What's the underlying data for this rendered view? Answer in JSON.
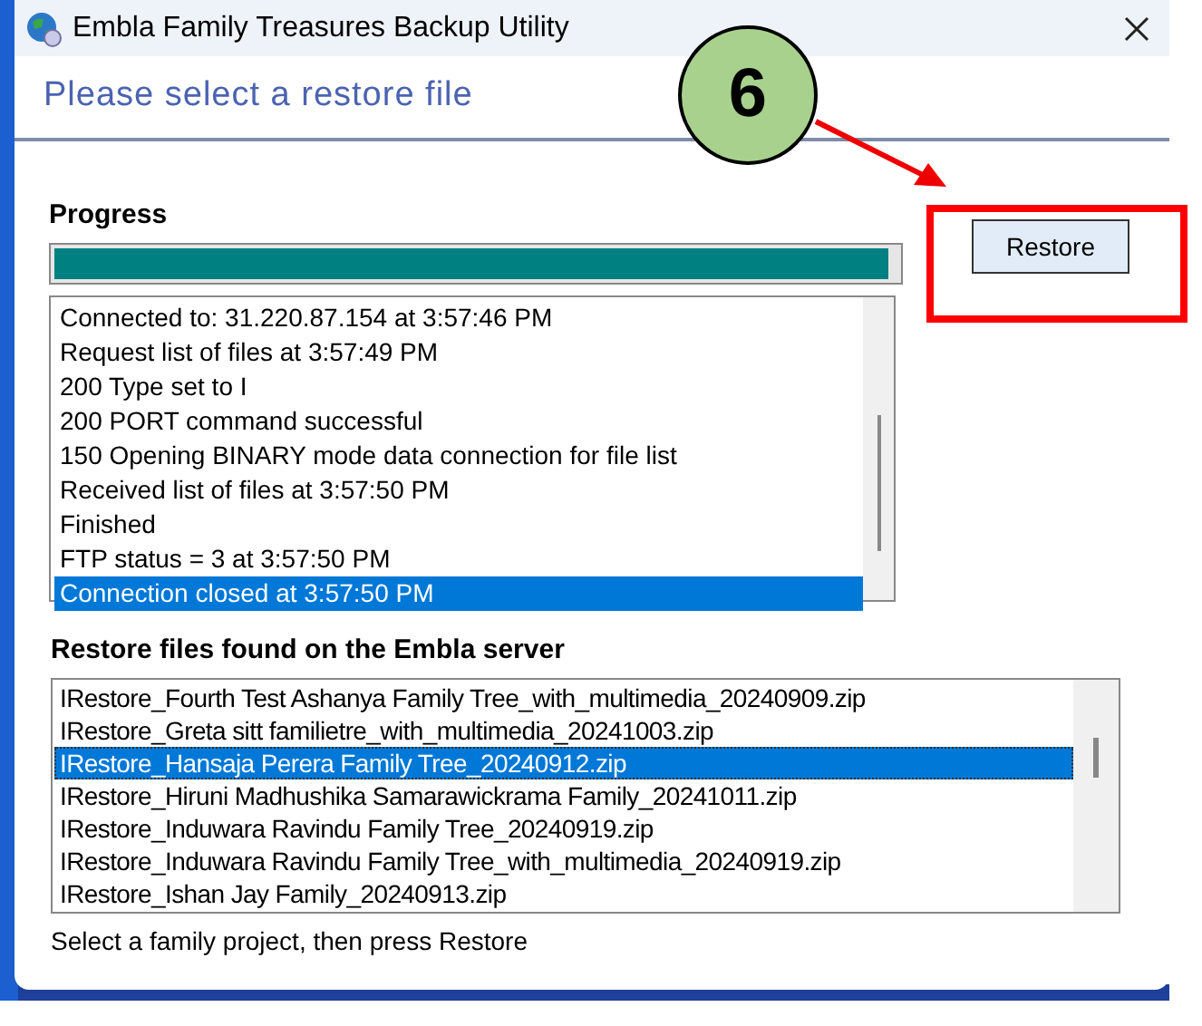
{
  "window": {
    "title": "Embla Family Treasures Backup Utility"
  },
  "header": {
    "title": "Please select a restore file"
  },
  "progress": {
    "label": "Progress",
    "level": 0.99
  },
  "log": {
    "lines": [
      {
        "text": "Connected to: 31.220.87.154 at 3:57:46 PM",
        "selected": false
      },
      {
        "text": "Request list of files at 3:57:49 PM",
        "selected": false
      },
      {
        "text": "200 Type set to I",
        "selected": false
      },
      {
        "text": "200 PORT command successful",
        "selected": false
      },
      {
        "text": "150 Opening BINARY mode data connection for file list",
        "selected": false
      },
      {
        "text": "Received list of files at 3:57:50 PM",
        "selected": false
      },
      {
        "text": "Finished",
        "selected": false
      },
      {
        "text": "FTP status = 3 at 3:57:50 PM",
        "selected": false
      },
      {
        "text": "Connection closed at 3:57:50 PM",
        "selected": true
      }
    ]
  },
  "restore_button": {
    "label": "Restore"
  },
  "files": {
    "label": "Restore files found on the Embla server",
    "items": [
      {
        "text": "IRestore_Fourth Test Ashanya Family Tree_with_multimedia_20240909.zip",
        "selected": false
      },
      {
        "text": "IRestore_Greta sitt familietre_with_multimedia_20241003.zip",
        "selected": false
      },
      {
        "text": "IRestore_Hansaja Perera Family Tree_20240912.zip",
        "selected": true
      },
      {
        "text": "IRestore_Hiruni Madhushika Samarawickrama Family_20241011.zip",
        "selected": false
      },
      {
        "text": "IRestore_Induwara Ravindu Family Tree_20240919.zip",
        "selected": false
      },
      {
        "text": "IRestore_Induwara Ravindu Family Tree_with_multimedia_20240919.zip",
        "selected": false
      },
      {
        "text": "IRestore_Ishan Jay Family_20240913.zip",
        "selected": false
      }
    ]
  },
  "status": "Select a family project, then press Restore",
  "annotation": {
    "step": "6"
  }
}
